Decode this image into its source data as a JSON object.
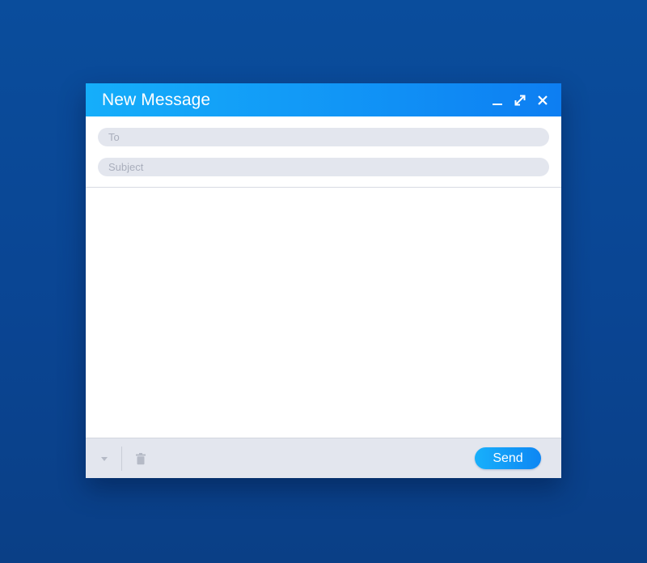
{
  "window": {
    "title": "New Message"
  },
  "fields": {
    "to": {
      "placeholder": "To",
      "value": ""
    },
    "subject": {
      "placeholder": "Subject",
      "value": ""
    }
  },
  "body": {
    "value": ""
  },
  "footer": {
    "send_label": "Send"
  },
  "icons": {
    "minimize": "minimize-icon",
    "maximize": "expand-arrows-icon",
    "close": "close-icon",
    "options": "caret-down-icon",
    "delete": "trash-icon"
  },
  "colors": {
    "background": "#0a4593",
    "title_bar_start": "#15aefa",
    "title_bar_end": "#0d7ef2",
    "field_bg": "#e3e6ee",
    "footer_bg": "#e3e6ee",
    "send_button": "#0d86f3"
  }
}
